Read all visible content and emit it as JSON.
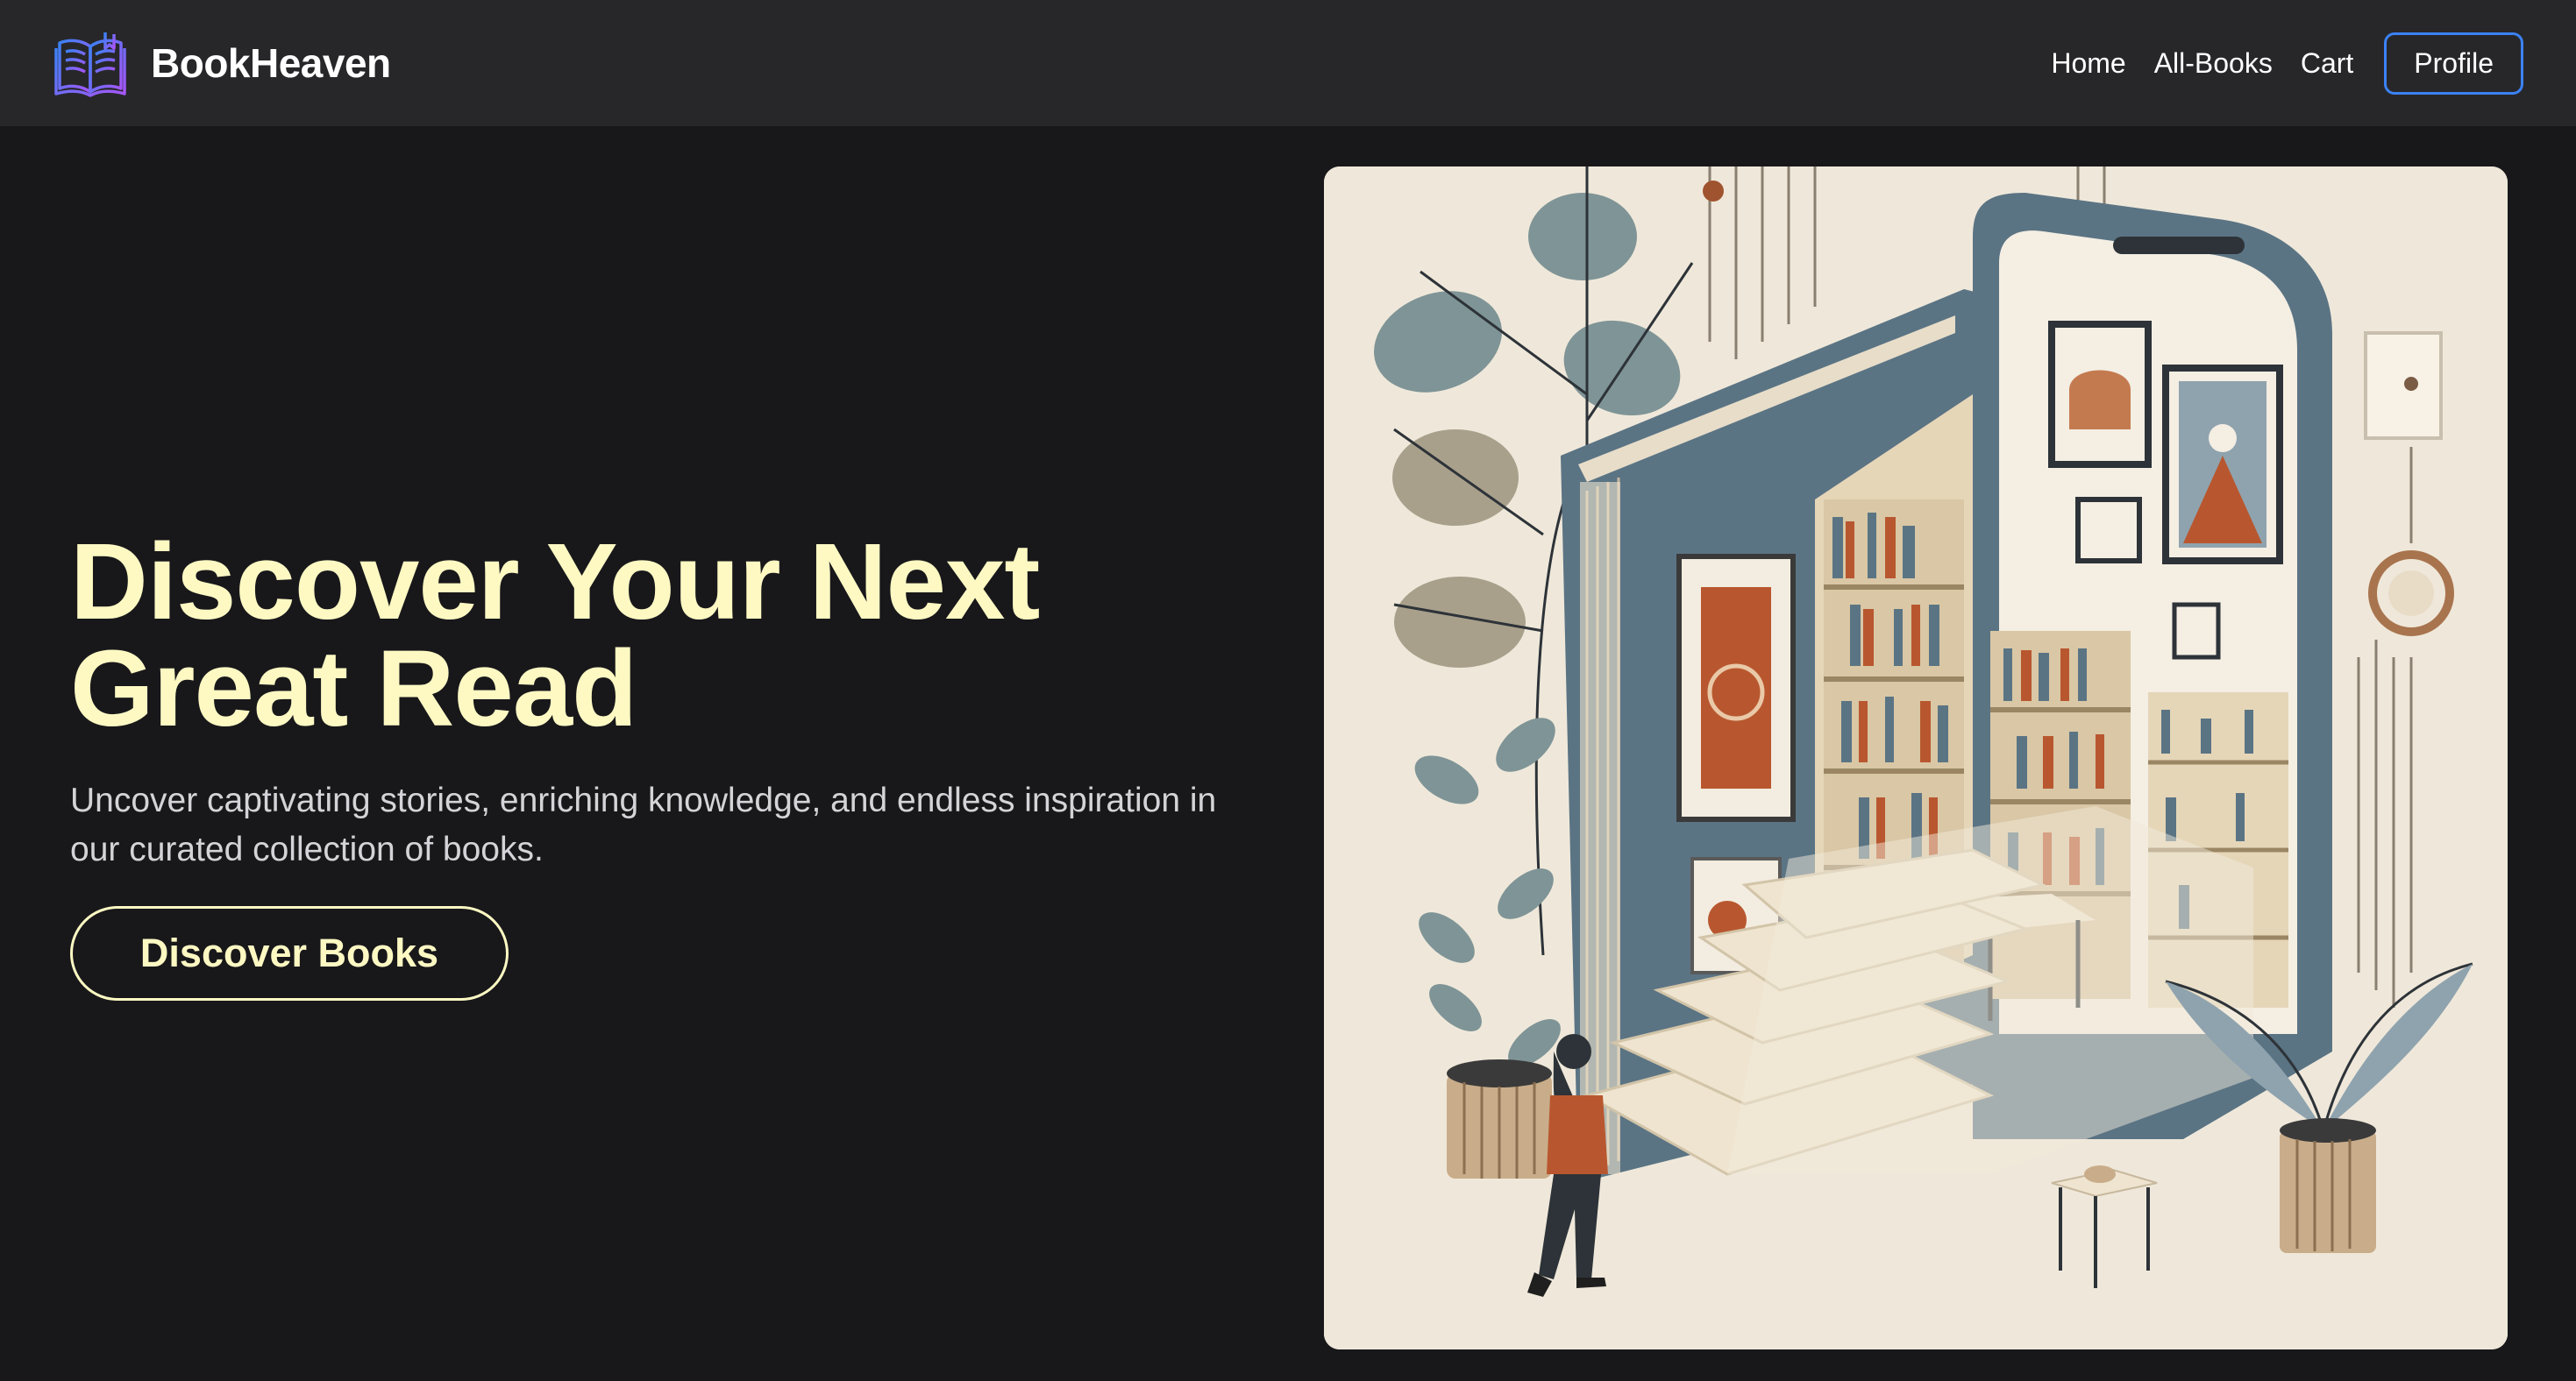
{
  "brand": {
    "name": "BookHeaven",
    "logo_icon": "open-book-icon"
  },
  "nav": {
    "links": [
      "Home",
      "All-Books",
      "Cart"
    ],
    "profile_label": "Profile"
  },
  "hero": {
    "title": "Discover Your Next Great Read",
    "subtitle": "Uncover captivating stories, enriching knowledge, and endless inspiration in our curated collection of books.",
    "cta_label": "Discover Books",
    "image_subject": "illustration of a giant book and smartphone opening into a library with bookshelves, stairs and a person walking in"
  },
  "colors": {
    "background": "#18181b",
    "navbar": "#27272a",
    "accent_yellow": "#fef9c3",
    "profile_border": "#3b82f6",
    "logo_gradient_start": "#3b82f6",
    "logo_gradient_end": "#a855f7"
  }
}
